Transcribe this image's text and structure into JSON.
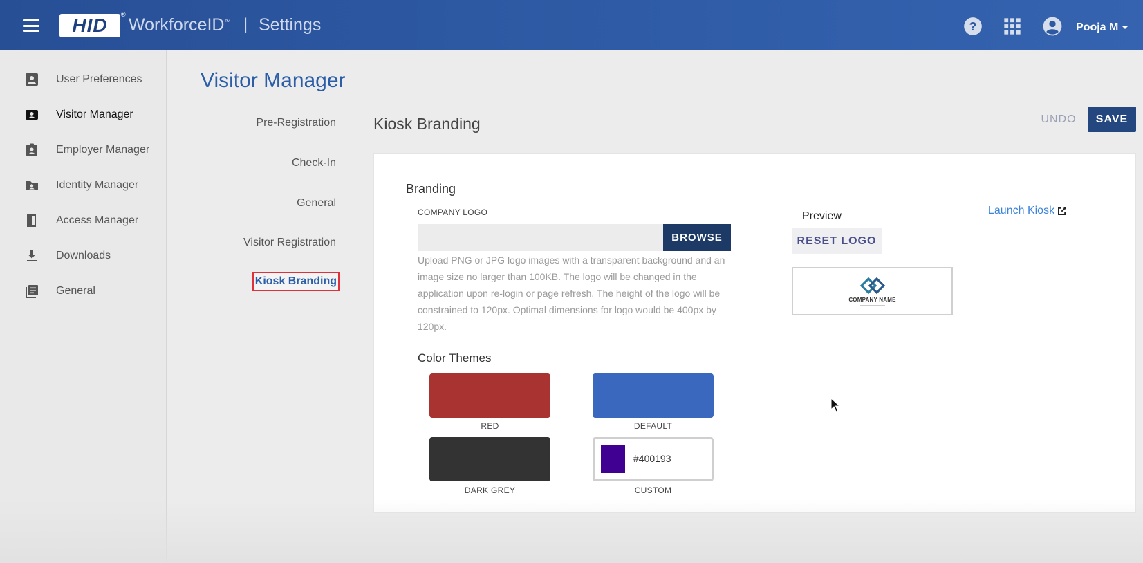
{
  "header": {
    "logo_text": "HID",
    "logo_mark": "®",
    "product": "WorkforceID",
    "product_mark": "™",
    "separator": "|",
    "page": "Settings",
    "user_name": "Pooja M",
    "icons": [
      "hamburger-menu-icon",
      "help-icon",
      "apps-grid-icon",
      "user-avatar-icon",
      "caret-down-icon"
    ]
  },
  "sidebar": {
    "items": [
      {
        "label": "User Preferences",
        "icon": "user-card-icon"
      },
      {
        "label": "Visitor Manager",
        "icon": "visitor-badge-icon",
        "active": true
      },
      {
        "label": "Employer Manager",
        "icon": "employee-badge-icon"
      },
      {
        "label": "Identity Manager",
        "icon": "identity-folder-icon"
      },
      {
        "label": "Access Manager",
        "icon": "door-icon"
      },
      {
        "label": "Downloads",
        "icon": "download-icon"
      },
      {
        "label": "General",
        "icon": "list-doc-icon"
      }
    ]
  },
  "page": {
    "title": "Visitor Manager"
  },
  "subnav": {
    "items": [
      {
        "label": "Pre-Registration"
      },
      {
        "label": "Check-In"
      },
      {
        "label": "General"
      },
      {
        "label": "Visitor Registration"
      },
      {
        "label": "Kiosk Branding",
        "active": true
      }
    ]
  },
  "content": {
    "section_title": "Kiosk Branding",
    "undo_label": "UNDO",
    "save_label": "SAVE",
    "branding": {
      "title": "Branding",
      "company_logo_label": "COMPANY LOGO",
      "file_value": "",
      "browse_label": "BROWSE",
      "help_text": "Upload PNG or JPG logo images with a transparent background and an image size no larger than 100KB. The logo will be changed in the application upon re-login or page refresh. The height of the logo will be constrained to 120px. Optimal dimensions for logo would be 400px by 120px.",
      "preview_label": "Preview",
      "reset_logo_label": "RESET LOGO",
      "preview_company_name": "COMPANY NAME",
      "launch_kiosk_label": "Launch Kiosk"
    },
    "color_themes": {
      "title": "Color Themes",
      "themes": [
        {
          "label": "RED",
          "color": "#a93330"
        },
        {
          "label": "DEFAULT",
          "color": "#3a68bf"
        },
        {
          "label": "DARK GREY",
          "color": "#333333"
        },
        {
          "label": "CUSTOM",
          "color": "#400193",
          "hex": "#400193"
        }
      ]
    }
  }
}
